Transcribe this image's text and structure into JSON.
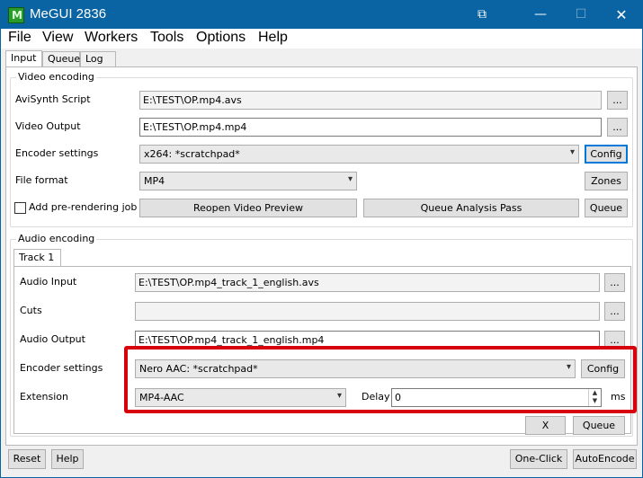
{
  "window": {
    "title": "MeGUI 2836"
  },
  "titlebar_buttons": {
    "minimize": "—",
    "maximize": "☐",
    "close": "✕"
  },
  "menu": [
    "File",
    "View",
    "Workers",
    "Tools",
    "Options",
    "Help"
  ],
  "tabs": [
    "Input",
    "Queue",
    "Log"
  ],
  "video": {
    "group_title": "Video encoding",
    "avisynth_label": "AviSynth Script",
    "avisynth_value": "E:\\TEST\\OP.mp4.avs",
    "output_label": "Video Output",
    "output_value": "E:\\TEST\\OP.mp4.mp4",
    "encoder_label": "Encoder settings",
    "encoder_value": "x264: *scratchpad*",
    "config_button": "Config",
    "format_label": "File format",
    "format_value": "MP4",
    "zones_button": "Zones",
    "prerender_label": "Add pre-rendering job",
    "reopen_button": "Reopen Video Preview",
    "analysis_button": "Queue Analysis Pass",
    "queue_button": "Queue",
    "browse_button": "..."
  },
  "audio": {
    "group_title": "Audio encoding",
    "track_tab": "Track 1",
    "input_label": "Audio Input",
    "input_value": "E:\\TEST\\OP.mp4_track_1_english.avs",
    "cuts_label": "Cuts",
    "cuts_value": "",
    "output_label": "Audio Output",
    "output_value": "E:\\TEST\\OP.mp4_track_1_english.mp4",
    "encoder_label": "Encoder settings",
    "encoder_value": "Nero AAC: *scratchpad*",
    "config_button": "Config",
    "extension_label": "Extension",
    "extension_value": "MP4-AAC",
    "delay_label": "Delay",
    "delay_value": "0",
    "delay_unit": "ms",
    "x_button": "X",
    "queue_button": "Queue",
    "browse_button": "..."
  },
  "bottom": {
    "reset_button": "Reset",
    "help_button": "Help",
    "oneclick_button": "One-Click",
    "autoencode_button": "AutoEncode"
  },
  "colors": {
    "titlebar": "#0a64a4",
    "highlight": "#d9000d",
    "focus": "#0078d7"
  }
}
